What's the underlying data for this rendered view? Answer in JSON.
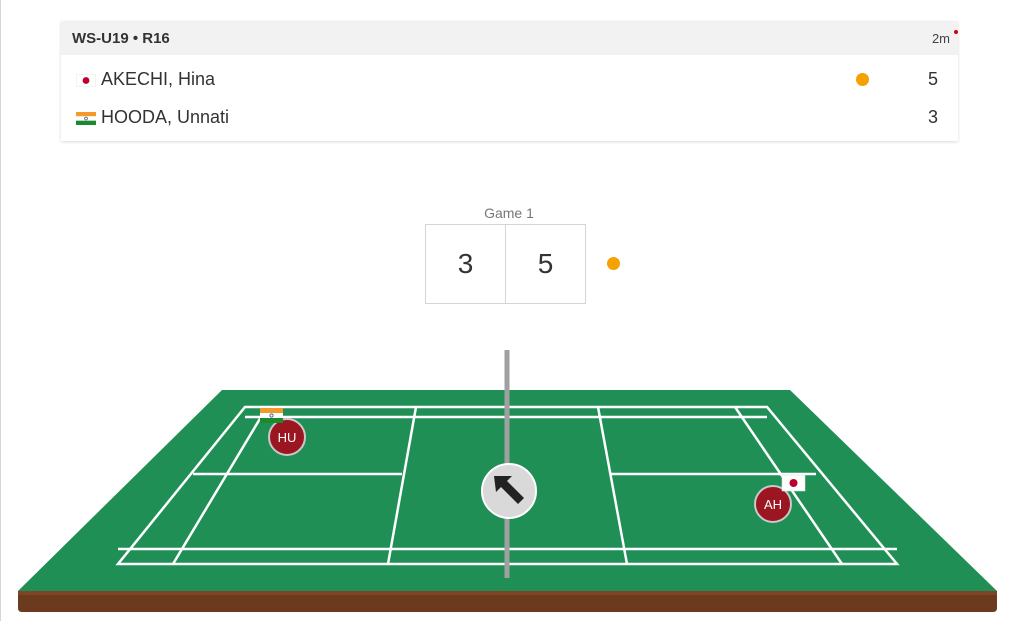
{
  "match": {
    "event": "WS-U19 • R16",
    "elapsed": "2m",
    "players": [
      {
        "name": "AKECHI, Hina",
        "country": "Japan",
        "score": "5",
        "serving": true,
        "initials": "AH"
      },
      {
        "name": "HOODA, Unnati",
        "country": "India",
        "score": "3",
        "serving": false,
        "initials": "HU"
      }
    ]
  },
  "game": {
    "label": "Game 1",
    "left_score": "3",
    "right_score": "5"
  },
  "colors": {
    "serve_indicator": "#f5a100",
    "court_green": "#1f8f55",
    "court_base": "#6b3a1f",
    "player_marker": "#9b1620"
  },
  "icons": {
    "direction_arrow": "arrow-up-left-icon"
  }
}
